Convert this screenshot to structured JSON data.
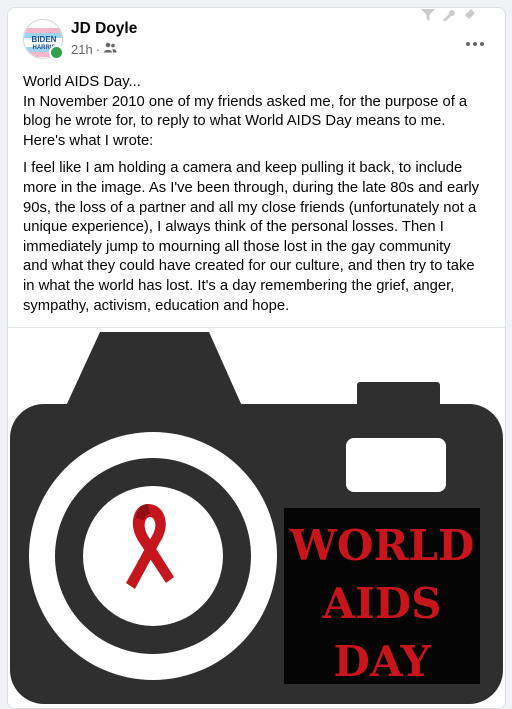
{
  "post": {
    "author": "JD Doyle",
    "time": "21h",
    "separator": "·",
    "avatar_text": [
      "BIDEN",
      "HARRIS"
    ],
    "title": "World AIDS Day...",
    "intro_lines": [
      "In November 2010 one of my friends asked me, for the purpose of a",
      "blog he wrote for, to reply to what World AIDS Day means to me.",
      "Here's what I wrote:"
    ],
    "body_lines": [
      "I feel like I am holding a camera and keep pulling it back, to include",
      "more in the image. As I've been through, during the late 80s and early",
      "90s, the loss of a partner and all my close friends (unfortunately not a",
      "unique experience), I always think of the personal losses. Then I",
      "immediately jump to mourning all those lost in the gay community",
      "and what they could have created for our culture, and then try to take",
      "in what the world has lost. It's a day remembering the grief, anger,",
      "sympathy, activism, education and hope."
    ]
  },
  "image": {
    "lines": [
      "WORLD",
      "AIDS",
      "DAY"
    ],
    "colors": {
      "camera": "#2f2f2f",
      "ribbon": "#c4161c",
      "text": "#c8141b",
      "text_panel": "#050505"
    }
  },
  "icons": {
    "audience": "friends-icon",
    "more": "more-options-icon",
    "top": [
      "filter-icon",
      "wrench-icon",
      "pin-icon"
    ]
  }
}
